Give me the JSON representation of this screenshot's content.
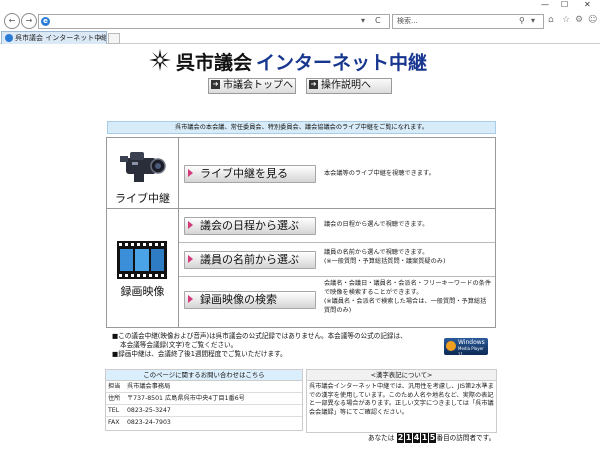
{
  "browser": {
    "window_controls": {
      "minimize": "—",
      "maximize": "☐",
      "close": "✕"
    },
    "address": {
      "value": "",
      "refresh": "C"
    },
    "search": {
      "placeholder": "検索..."
    },
    "tab": {
      "title": "呉市議会 インターネット中継"
    }
  },
  "header": {
    "title_black": "呉市議会",
    "title_blue": "インターネット中継",
    "nav": [
      {
        "label": "市議会トップへ"
      },
      {
        "label": "操作説明へ"
      }
    ]
  },
  "banner": "呉市議会の本会議、常任委員会、特別委員会、議会協議会のライブ中継をご覧になれます。",
  "sections": {
    "live": {
      "category": "ライブ中継",
      "button": "ライブ中継を見る",
      "description": "本会議等のライブ中継を視聴できます。"
    },
    "recorded": {
      "category": "録画映像",
      "rows": [
        {
          "button": "議会の日程から選ぶ",
          "description": "議会の日程から選んで視聴できます。"
        },
        {
          "button": "議員の名前から選ぶ",
          "description": "議員の名前から選んで視聴できます。",
          "note": "(※一般質問・予算総括質問・議案質疑のみ)"
        },
        {
          "button": "録画映像の検索",
          "description": "会議名・会議日・議員名・会派名・フリーキーワードの条件で映像を検索することができます。",
          "note": "(※議員名・会派名で検索した場合は、一般質問・予算総括質問のみ)"
        }
      ]
    }
  },
  "notes": [
    "■この議会中継(映像および音声)は呉市議会の公式記録ではありません。本会議等の公式の記録は、",
    "本会議等会議録(文字)をご覧ください。",
    "■録画中継は、会議終了後1週間程度でご覧いただけます。"
  ],
  "wmp_badge": {
    "line1": "Windows",
    "line2": "Media Player 11"
  },
  "contact": {
    "heading": "このページに関するお問い合わせはこちら",
    "rows": [
      {
        "key": "担当",
        "value": "呉市議会事務局"
      },
      {
        "key": "住所",
        "value": "〒737-8501 広島県呉市中央4丁目1番6号"
      },
      {
        "key": "TEL",
        "value": "0823-25-3247"
      },
      {
        "key": "FAX",
        "value": "0823-24-7903"
      }
    ]
  },
  "kanji_note": {
    "heading": "<漢字表記について>",
    "body": "呉市議会インターネット中継では、汎用性を考慮し、JIS第2水準までの漢字を使用しています。このため人名や地名など、実際の表記と一部異なる場合があります。正しい文字につきましては「呉市議会会議録」等にてご確認ください。"
  },
  "counter": {
    "prefix": "あなたは",
    "digits": [
      "2",
      "1",
      "4",
      "1",
      "5"
    ],
    "suffix": "番目の訪問者です。"
  },
  "colors": {
    "title_blue": "#17368f",
    "banner_bg": "#d7ebf9",
    "accent_pink": "#d23a7a"
  }
}
